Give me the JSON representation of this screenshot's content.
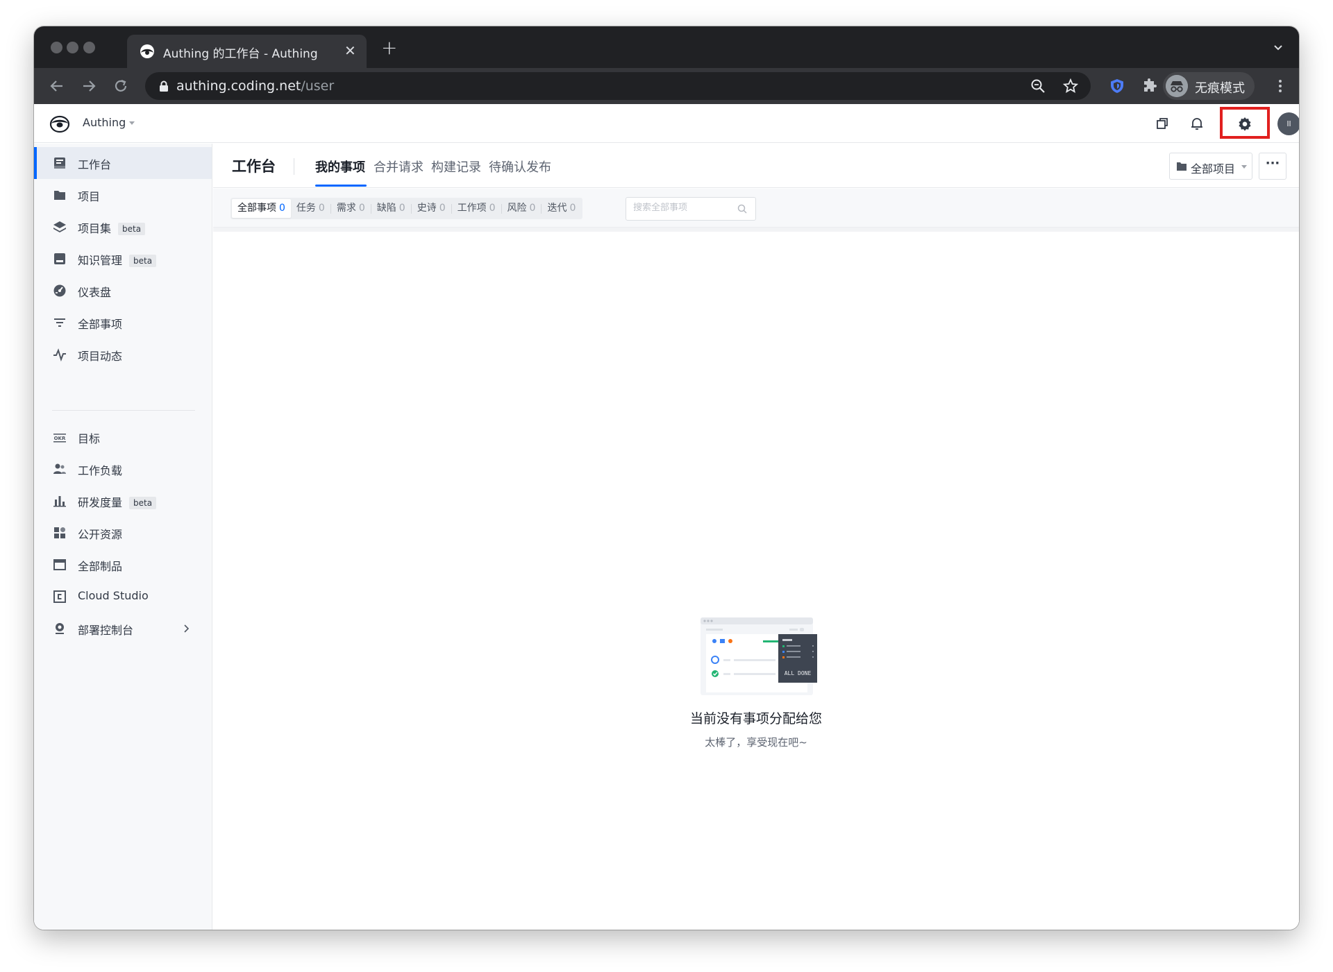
{
  "browser": {
    "tab_title": "Authing 的工作台 - Authing",
    "url_host": "authing.coding.net",
    "url_path": "/user",
    "incognito_label": "无痕模式"
  },
  "header": {
    "team_name": "Authing",
    "avatar_initial": "ll",
    "highlight_color": "#e1201f"
  },
  "sidebar": {
    "items": [
      {
        "label": "工作台",
        "icon": "workbench-icon",
        "active": true
      },
      {
        "label": "项目",
        "icon": "folder-icon"
      },
      {
        "label": "项目集",
        "icon": "layers-icon",
        "badge": "beta"
      },
      {
        "label": "知识管理",
        "icon": "book-icon",
        "badge": "beta"
      },
      {
        "label": "仪表盘",
        "icon": "dashboard-icon"
      },
      {
        "label": "全部事项",
        "icon": "filter-icon"
      },
      {
        "label": "项目动态",
        "icon": "activity-icon"
      },
      {
        "label": "目标",
        "icon": "okr-icon"
      },
      {
        "label": "工作负载",
        "icon": "users-icon"
      },
      {
        "label": "研发度量",
        "icon": "bar-chart-icon",
        "badge": "beta"
      },
      {
        "label": "公开资源",
        "icon": "grid-icon"
      },
      {
        "label": "全部制品",
        "icon": "package-icon"
      },
      {
        "label": "Cloud Studio",
        "icon": "cloud-studio-icon"
      },
      {
        "label": "部署控制台",
        "icon": "deploy-icon"
      }
    ]
  },
  "main": {
    "title": "工作台",
    "tabs": [
      {
        "label": "我的事项",
        "active": true
      },
      {
        "label": "合并请求"
      },
      {
        "label": "构建记录"
      },
      {
        "label": "待确认发布"
      }
    ],
    "project_filter": "全部项目",
    "more_label": "···"
  },
  "filters": {
    "segments": [
      {
        "label": "全部事项",
        "count": "0",
        "active": true
      },
      {
        "label": "任务",
        "count": "0"
      },
      {
        "label": "需求",
        "count": "0"
      },
      {
        "label": "缺陷",
        "count": "0"
      },
      {
        "label": "史诗",
        "count": "0"
      },
      {
        "label": "工作项",
        "count": "0"
      },
      {
        "label": "风险",
        "count": "0"
      },
      {
        "label": "迭代",
        "count": "0"
      }
    ],
    "search_placeholder": "搜索全部事项"
  },
  "empty_state": {
    "title": "当前没有事项分配给您",
    "subtitle": "太棒了，享受现在吧~",
    "illustration_text": "ALL DONE"
  },
  "colors": {
    "accent": "#0066ff",
    "sidebar_bg": "#f7f8fa",
    "chrome_dark": "#202124"
  }
}
